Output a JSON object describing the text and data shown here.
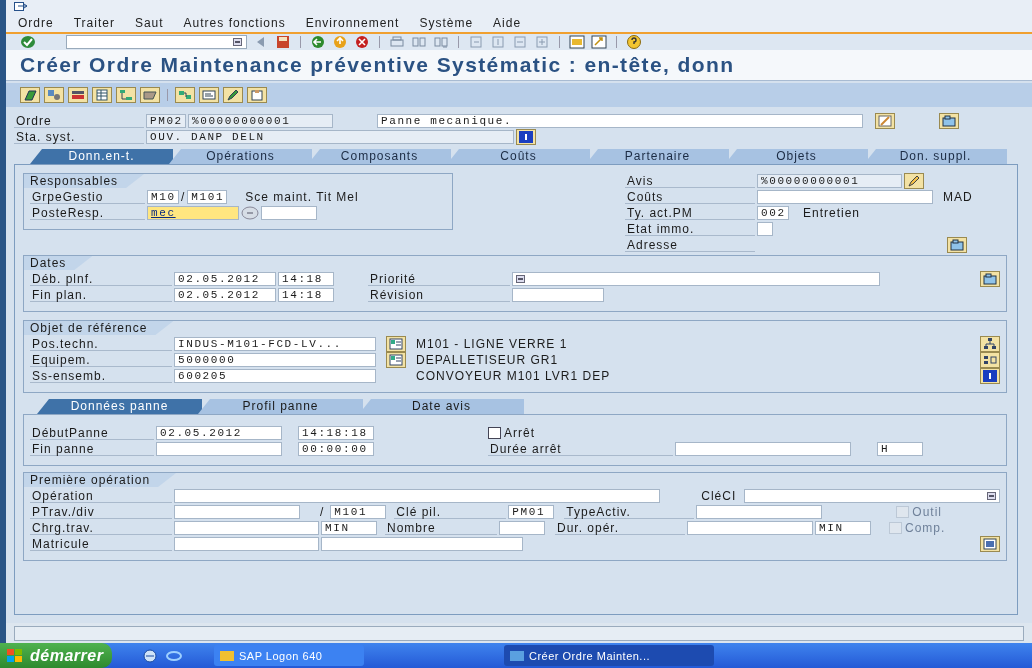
{
  "menu": [
    "Ordre",
    "Traiter",
    "Saut",
    "Autres fonctions",
    "Environnement",
    "Système",
    "Aide"
  ],
  "title": "Créer Ordre Maintenance préventive Systématic  : en-tête, donn",
  "header": {
    "order_label": "Ordre",
    "order_type": "PM02",
    "order_number": "%00000000001",
    "description": "Panne mecanique.",
    "status_label": "Sta. syst.",
    "status": "OUV.  DANP  DELN"
  },
  "tabs": [
    {
      "label": "Donn.en-t.",
      "selected": true
    },
    {
      "label": "Opérations",
      "selected": false
    },
    {
      "label": "Composants",
      "selected": false
    },
    {
      "label": "Coûts",
      "selected": false
    },
    {
      "label": "Partenaire",
      "selected": false
    },
    {
      "label": "Objets",
      "selected": false
    },
    {
      "label": "Don. suppl.",
      "selected": false
    }
  ],
  "responsables": {
    "title": "Responsables",
    "group_label": "GrpeGestio",
    "group": "M10",
    "separator": "/",
    "division": "M101",
    "group_text": "Sce maint. Tit Mel",
    "post_label": "PosteResp.",
    "post": "mec"
  },
  "side": {
    "notice_label": "Avis",
    "notice": "%00000000001",
    "costs_label": "Coûts",
    "costs_unit": "MAD",
    "activity_label": "Ty. act.PM",
    "activity": "002",
    "activity_text": "Entretien",
    "asset_label": "Etat immo.",
    "address_label": "Adresse"
  },
  "dates": {
    "title": "Dates",
    "rows": [
      {
        "label": "Déb. plnf.",
        "date": "02.05.2012",
        "time": "14:18"
      },
      {
        "label": "Fin plan.",
        "date": "02.05.2012",
        "time": "14:18"
      }
    ],
    "priority_label": "Priorité",
    "revision_label": "Révision"
  },
  "reference": {
    "title": "Objet de référence",
    "rows": [
      {
        "label": "Pos.techn.",
        "value": "INDUS-M101-FCD-LV...",
        "text": "M101 - LIGNE VERRE 1",
        "kind": "linked"
      },
      {
        "label": "Equipem.",
        "value": "5000000",
        "text": "DEPALLETISEUR GR1",
        "kind": "linked"
      },
      {
        "label": "Ss-ensemb.",
        "value": "600205",
        "text": "CONVOYEUR M101 LVR1 DEP",
        "kind": "plain"
      }
    ]
  },
  "subtabs": [
    {
      "label": "Données panne",
      "selected": true
    },
    {
      "label": "Profil panne",
      "selected": false
    },
    {
      "label": "Date avis",
      "selected": false
    }
  ],
  "breakdown": {
    "start_label": "DébutPanne",
    "start_date": "02.05.2012",
    "start_time": "14:18:18",
    "end_label": "Fin panne",
    "end_time": "00:00:00",
    "stop": {
      "label": "Arrêt",
      "checked": false,
      "disabled": false
    },
    "duration_label": "Durée arrêt",
    "duration_unit": "H"
  },
  "operation": {
    "title": "Première opération",
    "operation_label": "Opération",
    "control_key_label": "CléCI",
    "workcenter_label": "PTrav./div",
    "separator": "/",
    "division": "M101",
    "pilot_key_label": "Clé pil.",
    "pilot_key": "PM01",
    "activity_type_label": "TypeActiv.",
    "tool": {
      "label": "Outil",
      "checked": false,
      "disabled": true
    },
    "work_label": "Chrg.trav.",
    "work_unit": "MIN",
    "number_label": "Nombre",
    "duration_label": "Dur. opér.",
    "duration_unit": "MIN",
    "comp": {
      "label": "Comp.",
      "checked": false,
      "disabled": true
    },
    "personnel_label": "Matricule"
  },
  "taskbar": {
    "start": "démarrer",
    "items": [
      {
        "label": "SAP Logon 640",
        "selected": false
      },
      {
        "label": "Créer Ordre Mainten...",
        "selected": true
      }
    ]
  }
}
